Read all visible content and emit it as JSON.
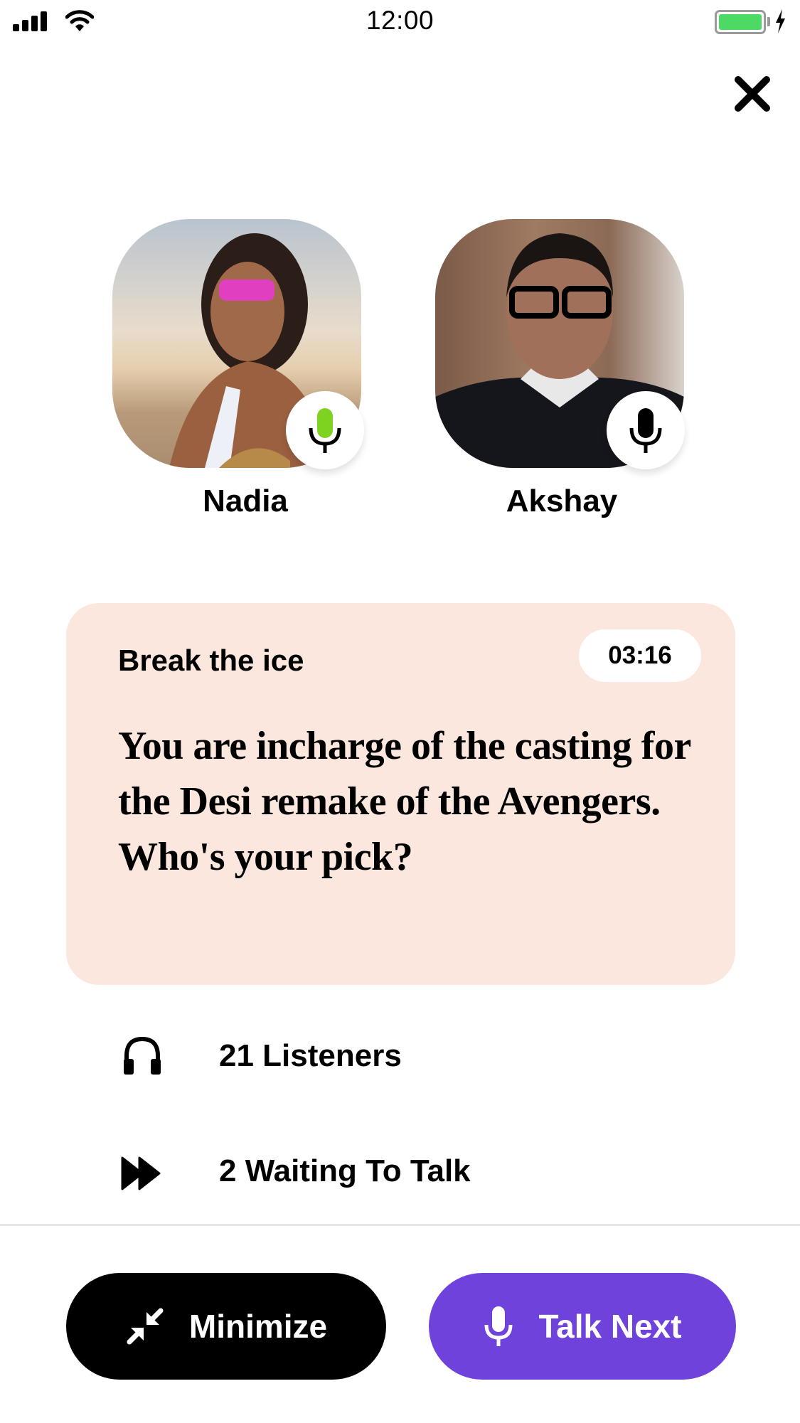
{
  "status_bar": {
    "time": "12:00",
    "signal_icon": "cellular-signal-icon",
    "wifi_icon": "wifi-icon",
    "battery_icon": "battery-charging-icon",
    "battery_color": "#4cd964"
  },
  "header": {
    "close_icon": "close-icon"
  },
  "speakers": [
    {
      "name": "Nadia",
      "mic_state": "active",
      "mic_color": "#7ed321"
    },
    {
      "name": "Akshay",
      "mic_state": "idle",
      "mic_color": "#000000"
    }
  ],
  "prompt_card": {
    "label": "Break the ice",
    "timer": "03:16",
    "prompt": "You are incharge of the casting for the Desi remake of the Avengers. Who's your pick?",
    "background": "#fce7de"
  },
  "stats": [
    {
      "icon": "headphones-icon",
      "label": "21 Listeners"
    },
    {
      "icon": "fast-forward-icon",
      "label": "2 Waiting To Talk"
    }
  ],
  "actions": {
    "minimize_label": "Minimize",
    "talk_next_label": "Talk Next",
    "talk_next_color": "#6f42db"
  }
}
